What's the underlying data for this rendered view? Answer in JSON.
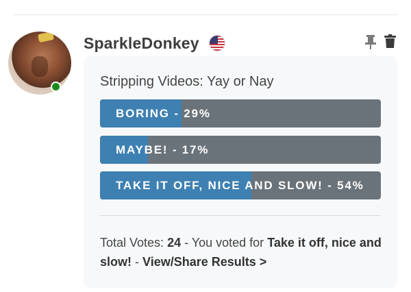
{
  "post": {
    "username": "SparkleDonkey",
    "flag_icon": "us-flag-icon",
    "pin_icon": "pin-icon",
    "trash_icon": "trash-icon",
    "online_status_color": "#1a8b1a"
  },
  "poll": {
    "question": "Stripping Videos: Yay or Nay",
    "options": [
      {
        "label": "BORING - 29%",
        "percent": 29
      },
      {
        "label": "MAYBE! - 17%",
        "percent": 17
      },
      {
        "label": "TAKE IT OFF, NICE AND SLOW! - 54%",
        "percent": 54
      }
    ],
    "colors": {
      "fill": "#3e80b2",
      "track": "#6b737a"
    },
    "total_votes_prefix": "Total Votes: ",
    "total_votes": "24",
    "voted_prefix": " - You voted for ",
    "voted_option": "Take it off, nice and slow!",
    "separator": " - ",
    "results_link": "View/Share Results >"
  }
}
